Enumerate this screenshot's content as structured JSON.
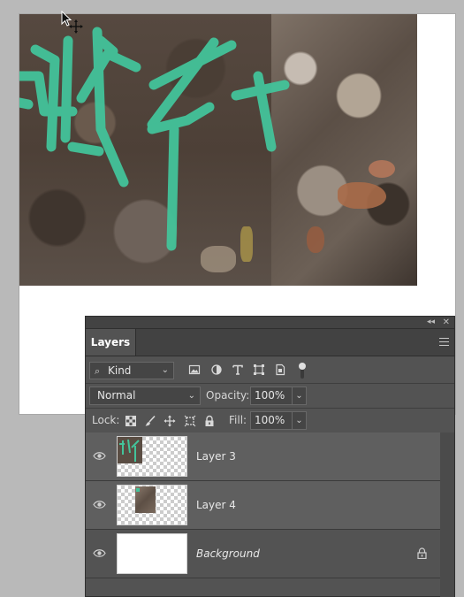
{
  "canvas": {
    "image_description_icon": "graffiti-wall-photo"
  },
  "panel": {
    "tab_label": "Layers",
    "filter": {
      "kind_label": "Kind",
      "icons": [
        "image-filter-icon",
        "adjustment-filter-icon",
        "type-filter-icon",
        "shape-filter-icon",
        "smart-object-filter-icon"
      ]
    },
    "blend_mode": "Normal",
    "opacity_label": "Opacity:",
    "opacity_value": "100%",
    "lock_label": "Lock:",
    "fill_label": "Fill:",
    "fill_value": "100%",
    "layers": [
      {
        "name": "Layer 3",
        "visible": true,
        "selected": true
      },
      {
        "name": "Layer 4",
        "visible": true,
        "selected": true
      },
      {
        "name": "Background",
        "visible": true,
        "selected": false,
        "locked": true
      }
    ]
  },
  "colors": {
    "graffiti": "#43c39a",
    "panel_bg": "#535353",
    "selected_layer_bg": "#5f5f5f"
  }
}
